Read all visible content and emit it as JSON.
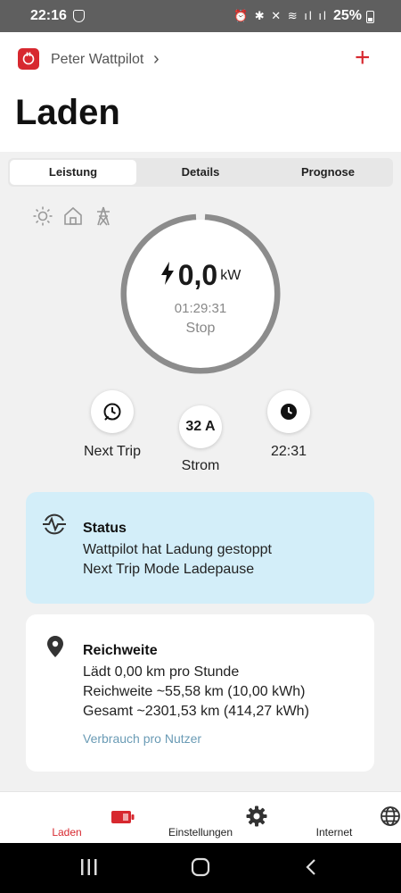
{
  "status_bar": {
    "time": "22:16",
    "right_icons": "⏰ ✱ ✕ ≋ ıl ıl",
    "battery": "25%"
  },
  "header": {
    "device_name": "Peter Wattpilot",
    "title": "Laden"
  },
  "tabs": [
    {
      "label": "Leistung",
      "active": true
    },
    {
      "label": "Details",
      "active": false
    },
    {
      "label": "Prognose",
      "active": false
    }
  ],
  "mode_icons": [
    "sun-icon",
    "house-icon",
    "power-tower-icon"
  ],
  "power": {
    "value": "0,0",
    "unit": "kW",
    "duration": "01:29:31",
    "state": "Stop"
  },
  "controls": {
    "next_trip_label": "Next Trip",
    "current_value": "32 A",
    "current_label": "Strom",
    "time_label": "22:31"
  },
  "status_card": {
    "title": "Status",
    "line1": "Wattpilot hat Ladung gestoppt",
    "line2": "Next Trip Mode Ladepause"
  },
  "range_card": {
    "title": "Reichweite",
    "line1": "Lädt 0,00 km pro Stunde",
    "line2": "Reichweite ~55,58 km (10,00 kWh)",
    "line3": "Gesamt ~2301,53 km (414,27 kWh)",
    "link": "Verbrauch pro Nutzer"
  },
  "bottom_nav": [
    {
      "label": "Laden",
      "icon": "battery-charging-icon",
      "active": true
    },
    {
      "label": "Einstellungen",
      "icon": "gear-icon",
      "active": false
    },
    {
      "label": "Internet",
      "icon": "globe-icon",
      "active": false
    }
  ],
  "colors": {
    "accent": "#d7282f",
    "status_card_bg": "#d3eef9",
    "link": "#6a9bb5",
    "ring": "#8c8c8c"
  }
}
